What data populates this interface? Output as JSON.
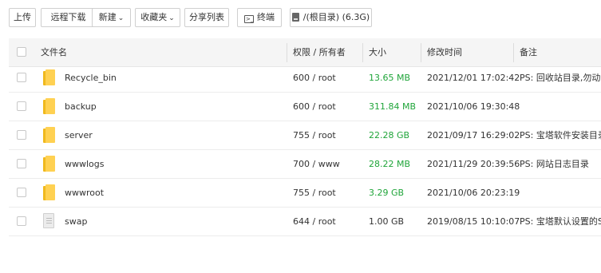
{
  "toolbar": {
    "upload": "上传",
    "remote_download": "远程下载",
    "new": "新建",
    "favorites": "收藏夹",
    "share_list": "分享列表",
    "terminal": "终端",
    "path": "/(根目录) (6.3G)"
  },
  "table": {
    "headers": {
      "name": "文件名",
      "perm": "权限 / 所有者",
      "size": "大小",
      "mtime": "修改时间",
      "note": "备注"
    },
    "rows": [
      {
        "name": "Recycle_bin",
        "perm": "600 / root",
        "size": "13.65 MB",
        "mtime": "2021/12/01 17:02:42",
        "note": "PS: 回收站目录,勿动",
        "type": "folder",
        "size_color": "green"
      },
      {
        "name": "backup",
        "perm": "600 / root",
        "size": "311.84 MB",
        "mtime": "2021/10/06 19:30:48",
        "note": "",
        "type": "folder",
        "size_color": "green"
      },
      {
        "name": "server",
        "perm": "755 / root",
        "size": "22.28 GB",
        "mtime": "2021/09/17 16:29:02",
        "note": "PS: 宝塔软件安装目录",
        "type": "folder",
        "size_color": "green"
      },
      {
        "name": "wwwlogs",
        "perm": "700 / www",
        "size": "28.22 MB",
        "mtime": "2021/11/29 20:39:56",
        "note": "PS: 网站日志目录",
        "type": "folder",
        "size_color": "green"
      },
      {
        "name": "wwwroot",
        "perm": "755 / root",
        "size": "3.29 GB",
        "mtime": "2021/10/06 20:23:19",
        "note": "",
        "type": "folder",
        "size_color": "green"
      },
      {
        "name": "swap",
        "perm": "644 / root",
        "size": "1.00 GB",
        "mtime": "2019/08/15 10:10:07",
        "note": "PS: 宝塔默认设置的SWAP交换分区文件",
        "type": "file",
        "size_color": "default"
      }
    ]
  },
  "colors": {
    "size_green": "#20a53a",
    "folder": "#ffd152",
    "header_bg": "#f5f5f5"
  }
}
